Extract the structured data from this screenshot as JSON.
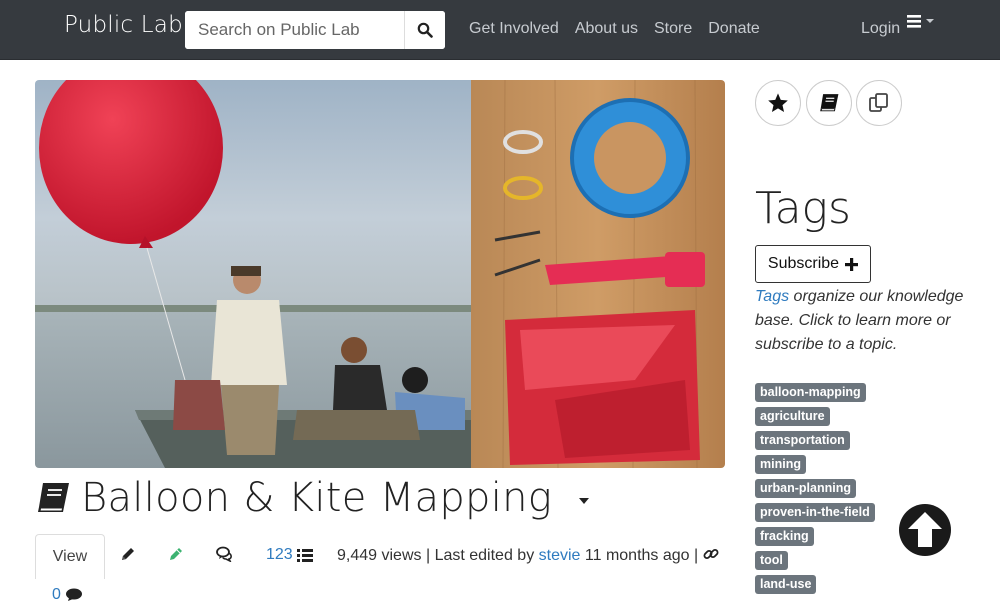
{
  "nav": {
    "brand": "Public Lab",
    "search_placeholder": "Search on Public Lab",
    "links": [
      "Get Involved",
      "About us",
      "Store",
      "Donate"
    ],
    "login": "Login"
  },
  "page": {
    "title": "Balloon & Kite Mapping",
    "tabs": {
      "view": "View"
    },
    "revision_count": "123",
    "meta": {
      "views": "9,449 views",
      "edited_prefix": "Last edited by",
      "user": "stevie",
      "time": "11 months ago",
      "separator": "|"
    },
    "comment_count": "0"
  },
  "sidebar": {
    "heading": "Tags",
    "subscribe_label": "Subscribe",
    "desc_link": "Tags",
    "desc_text": " organize our knowledge base. Click to learn more or subscribe to a topic.",
    "tags": [
      "balloon-mapping",
      "agriculture",
      "transportation",
      "mining",
      "urban-planning",
      "proven-in-the-field",
      "fracking",
      "tool",
      "land-use"
    ]
  },
  "icons": {
    "search": "search-icon",
    "menu": "hamburger-icon",
    "star": "star-icon",
    "book": "book-icon",
    "copy": "copy-icon",
    "pencil": "pencil-icon",
    "edit": "edit-icon",
    "comments": "comments-icon",
    "list": "list-icon",
    "link": "link-icon",
    "comment": "comment-icon",
    "plus": "plus-icon",
    "arrow_up": "arrow-circle-up-icon"
  },
  "colors": {
    "nav_bg": "#363a3f",
    "link": "#2f7bbf",
    "tag_bg": "#6c757d",
    "green": "#3cb371"
  }
}
